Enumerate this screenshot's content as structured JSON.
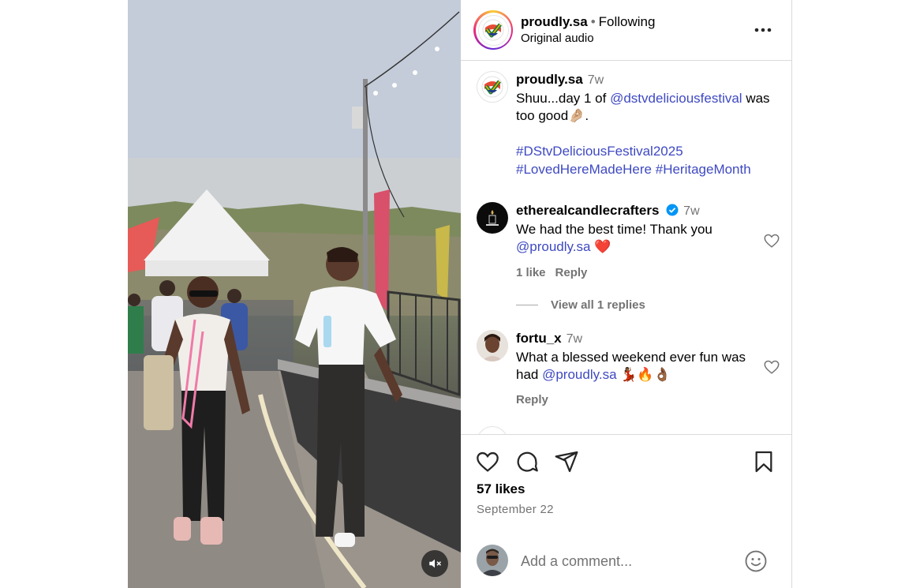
{
  "post_header": {
    "username": "proudly.sa",
    "separator": "•",
    "follow_status": "Following",
    "audio": "Original audio"
  },
  "caption": {
    "username": "proudly.sa",
    "age": "7w",
    "text_1": "Shuu...day 1 of ",
    "mention": "@dstvdeliciousfestival",
    "text_2": " was too good🤌🏼.",
    "hashtag_1": "#DStvDeliciousFestival2025",
    "hashtag_2": "#LovedHereMadeHere",
    "hashtag_3": "#HeritageMonth"
  },
  "comments": [
    {
      "username": "etherealcandlecrafters",
      "verified": true,
      "age": "7w",
      "text": "We had the best time! Thank you ",
      "mention": "@proudly.sa",
      "emoji": " ❤️",
      "likes": "1 like",
      "reply_label": "Reply",
      "view_replies": "View all 1 replies"
    },
    {
      "username": "fortu_x",
      "age": "7w",
      "text": "What a blessed weekend ever fun was had ",
      "mention": "@proudly.sa",
      "emoji": " 💃🏾🔥👌🏾",
      "reply_label": "Reply"
    }
  ],
  "footer": {
    "likes": "57 likes",
    "date": "September 22",
    "comment_placeholder": "Add a comment..."
  },
  "colors": {
    "link": "#3e49c2",
    "muted": "#737373",
    "border": "#dbdbdb",
    "verified": "#0095f6",
    "heart": "#ed4956"
  },
  "icons": [
    "more-icon",
    "heart-icon",
    "comment-icon",
    "share-icon",
    "bookmark-icon",
    "emoji-icon",
    "mute-icon",
    "verified-icon"
  ]
}
